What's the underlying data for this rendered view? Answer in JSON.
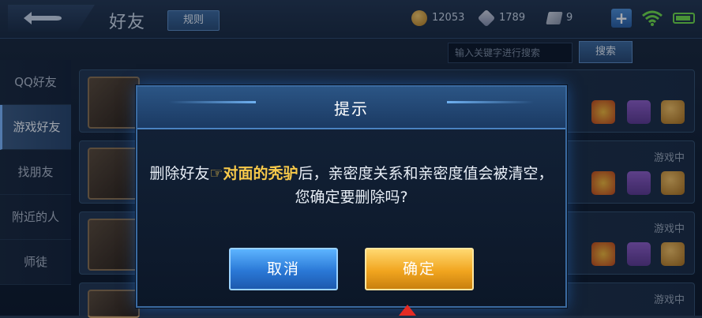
{
  "header": {
    "title": "好友",
    "rules_label": "规则",
    "coins": "12053",
    "gems": "1789",
    "tickets": "9"
  },
  "search": {
    "placeholder": "输入关键字进行搜索",
    "button_label": "搜索"
  },
  "sidebar": {
    "items": [
      {
        "label": "QQ好友"
      },
      {
        "label": "游戏好友"
      },
      {
        "label": "找朋友"
      },
      {
        "label": "附近的人"
      },
      {
        "label": "师徒"
      }
    ],
    "active_index": 1
  },
  "friends": [
    {
      "status": ""
    },
    {
      "status": "游戏中"
    },
    {
      "status": "游戏中"
    },
    {
      "status": "游戏中"
    }
  ],
  "dialog": {
    "title": "提示",
    "message_before": "删除好友",
    "pointer_glyph": "☞",
    "friend_name": "对面的秃驴",
    "message_after": "后，亲密度关系和亲密度值会被清空，您确定要删除吗?",
    "cancel_label": "取消",
    "confirm_label": "确定"
  },
  "colors": {
    "highlight": "#f7c94a",
    "cancel_button": "#2a78d6",
    "confirm_button": "#f1a51f",
    "arrow": "#e42a23"
  }
}
